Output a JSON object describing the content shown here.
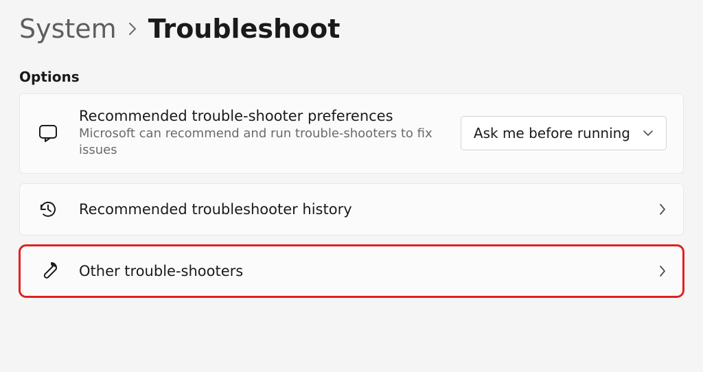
{
  "breadcrumb": {
    "parent": "System",
    "current": "Troubleshoot"
  },
  "section_label": "Options",
  "preferences": {
    "title": "Recommended trouble-shooter preferences",
    "description": "Microsoft can recommend and run trouble-shooters to fix issues",
    "dropdown_value": "Ask me before running"
  },
  "history": {
    "title": "Recommended troubleshooter history"
  },
  "other": {
    "title": "Other trouble-shooters"
  }
}
